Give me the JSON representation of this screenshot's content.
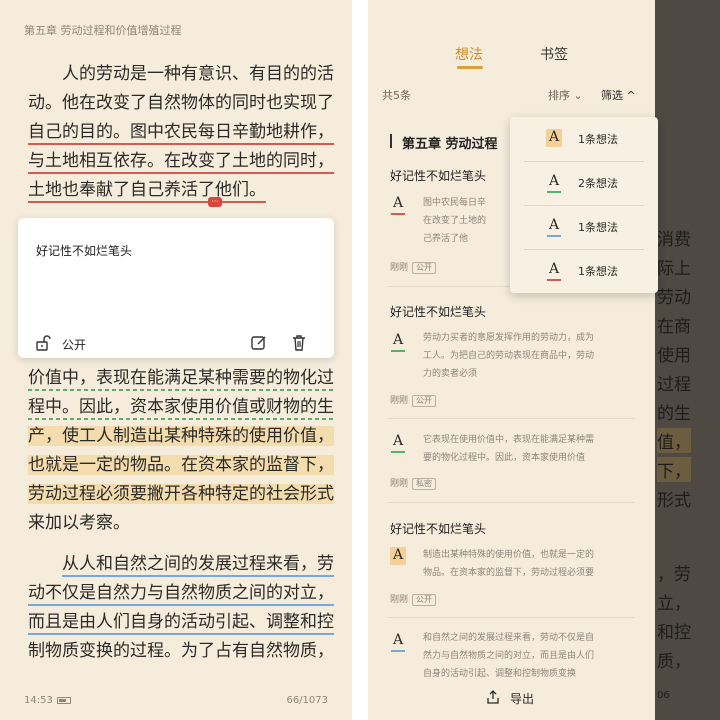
{
  "reader": {
    "chapter_header": "第五章 劳动过程和价值增殖过程",
    "para1": [
      "人的劳动是一种有意识、有目的的活",
      "动。他在改变了自然物体的同时也实现了",
      "自己的目的。图中农民每日辛勤地耕作，",
      "与土地相互依存。在改变了土地的同时，",
      "土地也奉献了自己养活了他们。"
    ],
    "para2": [
      "价值中，表现在能满足某种需要的物化过",
      "程中。因此，资本家使用价值或财物的生",
      "产，使工人制造出某种特殊的使用价值，",
      "也就是一定的物品。在资本家的监督下，",
      "劳动过程必须要撇开各种特定的社会形式",
      "来加以考察。"
    ],
    "para3": [
      "从人和自然之间的发展过程来看，劳",
      "动不仅是自然力与自然物质之间的对立，",
      "而且是由人们自身的活动引起、调整和控",
      "制物质变换的过程。为了占有自然物质，"
    ],
    "note_marker": "···",
    "popup": {
      "note": "好记性不如烂笔头",
      "visibility": "公开"
    },
    "status": {
      "time": "14:53",
      "page": "66/1073"
    }
  },
  "panel": {
    "tabs": [
      "想法",
      "书签"
    ],
    "count": "共5条",
    "sort_label": "排序",
    "filter_label": "筛选",
    "section_title": "第五章 劳动过程",
    "notes": [
      {
        "title": "好记性不如烂笔头",
        "text": [
          "图中农民每日辛",
          "在改变了土地的",
          "己养活了他"
        ],
        "time": "刚刚",
        "tag": "公开",
        "style": "red"
      },
      {
        "title": "好记性不如烂笔头",
        "text": [
          "劳动力买者的意愿发挥作用的劳动力，成为",
          "工人。为把自己的劳动表现在商品中，劳动",
          "力的卖者必须"
        ],
        "time": "刚刚",
        "tag": "公开",
        "style": "green"
      },
      {
        "title": "",
        "text": [
          "它表现在使用价值中，表现在能满足某种需",
          "要的物化过程中。因此，资本家使用价值"
        ],
        "time": "刚刚",
        "tag": "私密",
        "style": "green"
      },
      {
        "title": "好记性不如烂笔头",
        "text": [
          "制造出某种特殊的使用价值，也就是一定的",
          "物品。在资本家的监督下，劳动过程必须要"
        ],
        "time": "刚刚",
        "tag": "公开",
        "style": "highlight"
      },
      {
        "title": "",
        "text": [
          "和自然之间的发展过程来看，劳动不仅是自",
          "然力与自然物质之间的对立，而且是由人们",
          "自身的活动引起、调整和控制物质变换"
        ],
        "time": "",
        "tag": "",
        "style": "blue"
      }
    ],
    "export_label": "导出",
    "dropdown": [
      {
        "label": "1条想法",
        "style": "highlight"
      },
      {
        "label": "2条想法",
        "style": "green"
      },
      {
        "label": "1条想法",
        "style": "blue"
      },
      {
        "label": "1条想法",
        "style": "red"
      }
    ],
    "bg_lines": [
      "消费",
      "际上",
      "劳动",
      "在商",
      "使用",
      "过程",
      "的生",
      "值，",
      "下，",
      "形式",
      "，劳",
      "立，",
      "和控",
      "质，"
    ],
    "bg_footer": "06"
  },
  "colors": {
    "accent": "#d9a03a",
    "red_underline": "#d25a4e",
    "green_underline": "#59b06a",
    "blue_underline": "#7aa7d8",
    "highlight": "#f3dcae",
    "page_bg": "#f5ecdc"
  },
  "icons": [
    "unlock-icon",
    "edit-icon",
    "trash-icon",
    "export-icon",
    "chevron-down-icon",
    "chevron-up-icon",
    "battery-icon"
  ]
}
